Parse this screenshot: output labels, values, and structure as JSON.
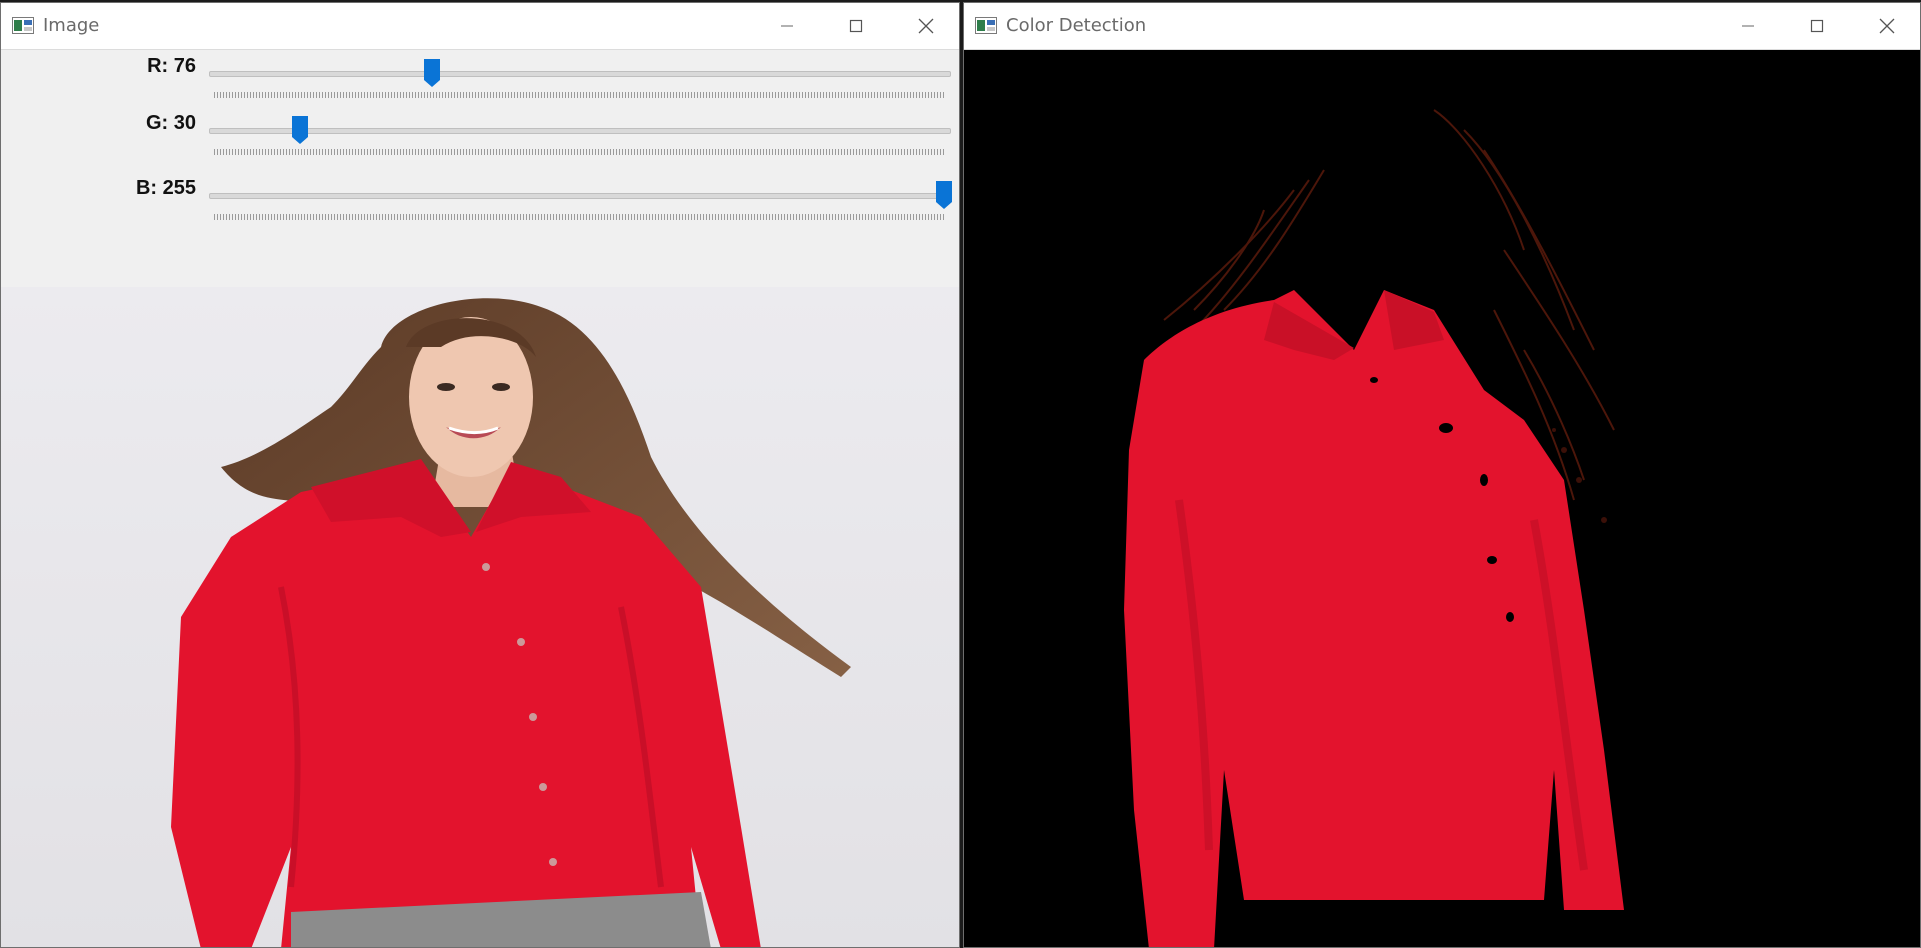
{
  "windows": {
    "image": {
      "title": "Image",
      "icon": "app-window-icon",
      "trackbars": [
        {
          "label": "R: 76",
          "name": "R",
          "value": 76,
          "max": 255
        },
        {
          "label": "G: 30",
          "name": "G",
          "value": 30,
          "max": 255
        },
        {
          "label": "B: 255",
          "name": "B",
          "value": 255,
          "max": 255
        }
      ],
      "content": "photo of a woman in a red shirt"
    },
    "detect": {
      "title": "Color Detection",
      "icon": "app-window-icon",
      "content": "mask result showing only red regions on black"
    }
  },
  "caption_buttons": [
    "minimize-icon",
    "maximize-icon",
    "close-icon"
  ],
  "colors": {
    "shirt_red": "#e3132d",
    "thumb_blue": "#0a74d6",
    "mask_background": "#000000",
    "photo_background": "#e9e8ec"
  }
}
